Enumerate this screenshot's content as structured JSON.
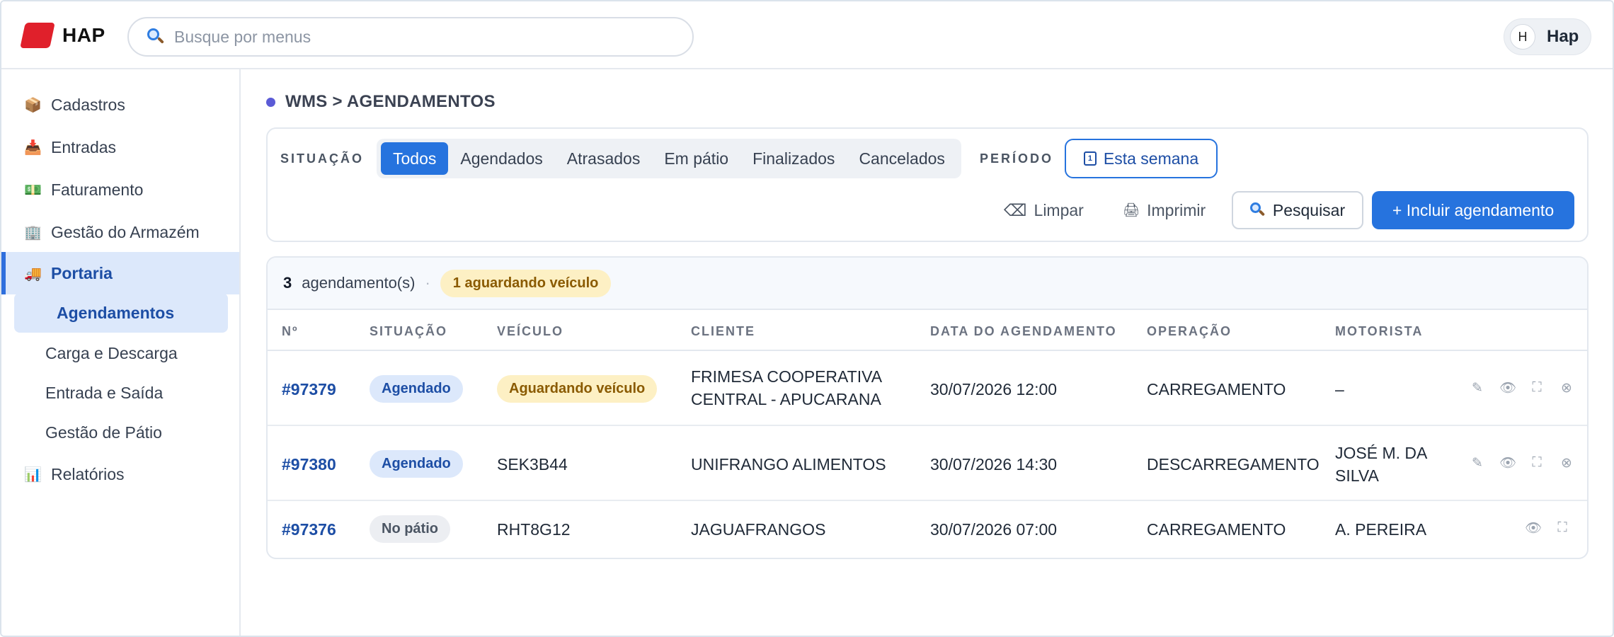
{
  "header": {
    "logo_text": "HAP",
    "search_placeholder": "Busque por menus",
    "user_initial": "H",
    "user_name": "Hap"
  },
  "sidebar": {
    "items": [
      {
        "icon": "📦",
        "label": "Cadastros"
      },
      {
        "icon": "📥",
        "label": "Entradas"
      },
      {
        "icon": "💵",
        "label": "Faturamento"
      },
      {
        "icon": "🏢",
        "label": "Gestão do Armazém"
      },
      {
        "icon": "🚚",
        "label": "Portaria"
      },
      {
        "icon": "📊",
        "label": "Relatórios"
      }
    ],
    "subitems": [
      "Agendamentos",
      "Carga e Descarga",
      "Entrada e Saída",
      "Gestão de Pátio"
    ]
  },
  "breadcrumb": "WMS > AGENDAMENTOS",
  "filters": {
    "situacao_label": "SITUAÇÃO",
    "tabs": [
      "Todos",
      "Agendados",
      "Atrasados",
      "Em pátio",
      "Finalizados",
      "Cancelados"
    ],
    "periodo_label": "PERÍODO",
    "periodo_value": "Esta semana",
    "calendar_glyph": "1",
    "clear_icon": "⌫",
    "clear_label": "Limpar",
    "print_icon": "🖨",
    "print_label": "Imprimir",
    "search_label": "Pesquisar",
    "add_label": "+ Incluir agendamento"
  },
  "summary": {
    "count": "3",
    "count_label": "agendamento(s)",
    "separator": "·",
    "waiting_badge": "1 aguardando veículo"
  },
  "table": {
    "headers": [
      "Nº",
      "SITUAÇÃO",
      "VEÍCULO",
      "CLIENTE",
      "DATA DO AGENDAMENTO",
      "OPERAÇÃO",
      "MOTORISTA"
    ],
    "rows": [
      {
        "num": "#97379",
        "status": "Agendado",
        "vehicle": "Aguardando veículo",
        "client": "FRIMESA COOPERATIVA CENTRAL - APUCARANA",
        "date": "30/07/2026 12:00",
        "operation": "CARREGAMENTO",
        "driver": "–"
      },
      {
        "num": "#97380",
        "status": "Agendado",
        "vehicle": "SEK3B44",
        "client": "UNIFRANGO ALIMENTOS",
        "date": "30/07/2026 14:30",
        "operation": "DESCARREGAMENTO",
        "driver": "JOSÉ M. DA SILVA"
      },
      {
        "num": "#97376",
        "status": "No pátio",
        "vehicle": "RHT8G12",
        "client": "JAGUAFRANGOS",
        "date": "30/07/2026 07:00",
        "operation": "CARREGAMENTO",
        "driver": "A. PEREIRA"
      }
    ],
    "action_icons": {
      "edit": "✎",
      "view": "👁",
      "expand": "⛶",
      "cancel": "⊗"
    }
  },
  "colors": {
    "primary": "#2673de",
    "active_bg": "#dce8fb",
    "warning_bg": "#fdf0c4",
    "logo_red": "#e0202b"
  }
}
